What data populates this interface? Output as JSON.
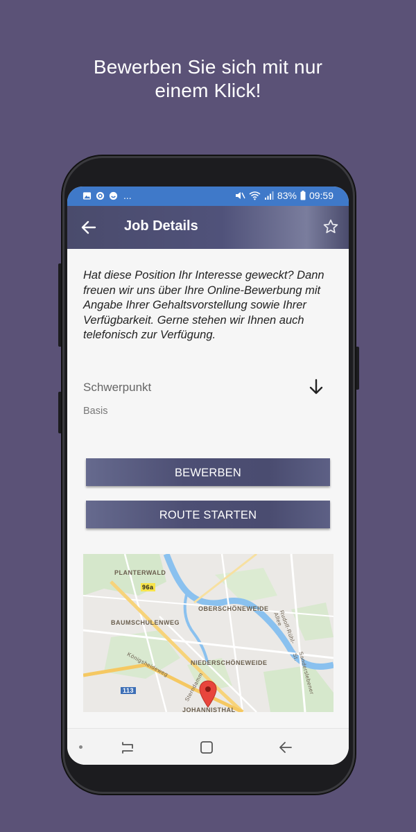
{
  "promo": {
    "line1": "Bewerben Sie sich mit nur",
    "line2": "einem Klick!"
  },
  "status_bar": {
    "notifications": [
      "image-icon",
      "target-icon",
      "emoji-icon"
    ],
    "more": "...",
    "battery": "83%",
    "time": "09:59",
    "bar_color": "#3f79c9"
  },
  "app_bar": {
    "title": "Job Details",
    "back_icon": "arrow-left-icon",
    "favorite_icon": "star-outline-icon"
  },
  "job": {
    "description": "Hat diese Position Ihr Interesse geweckt? Dann freuen wir uns über Ihre Online-Bewerbung mit Angabe Ihrer Gehaltsvorstellung sowie Ihrer Verfügbarkeit. Gerne stehen wir Ihnen auch telefonisch zur Verfügung.",
    "focus_label": "Schwerpunkt",
    "focus_value": "Basis"
  },
  "actions": {
    "apply_label": "BEWERBEN",
    "route_label": "ROUTE STARTEN"
  },
  "map": {
    "labels": {
      "planterwald": "PLANTERWALD",
      "route_96a": "96a",
      "oberschoeneweide": "OBERSCHÖNEWEIDE",
      "baumschulenweg": "BAUMSCHULENWEG",
      "rudolf": "Rudolf-Rühl-Allee",
      "koenigsheideweg": "Königsheideweg",
      "niederschoeneweide": "NIEDERSCHÖNEWEIDE",
      "sandersleben": "Sanderslebener St.",
      "route_113": "113",
      "sterndamm": "Sterndamm",
      "johannisthal": "JOHANNISTHAL"
    }
  },
  "nav_bar": {
    "items": [
      "recent-apps-icon",
      "home-icon",
      "back-icon"
    ]
  }
}
